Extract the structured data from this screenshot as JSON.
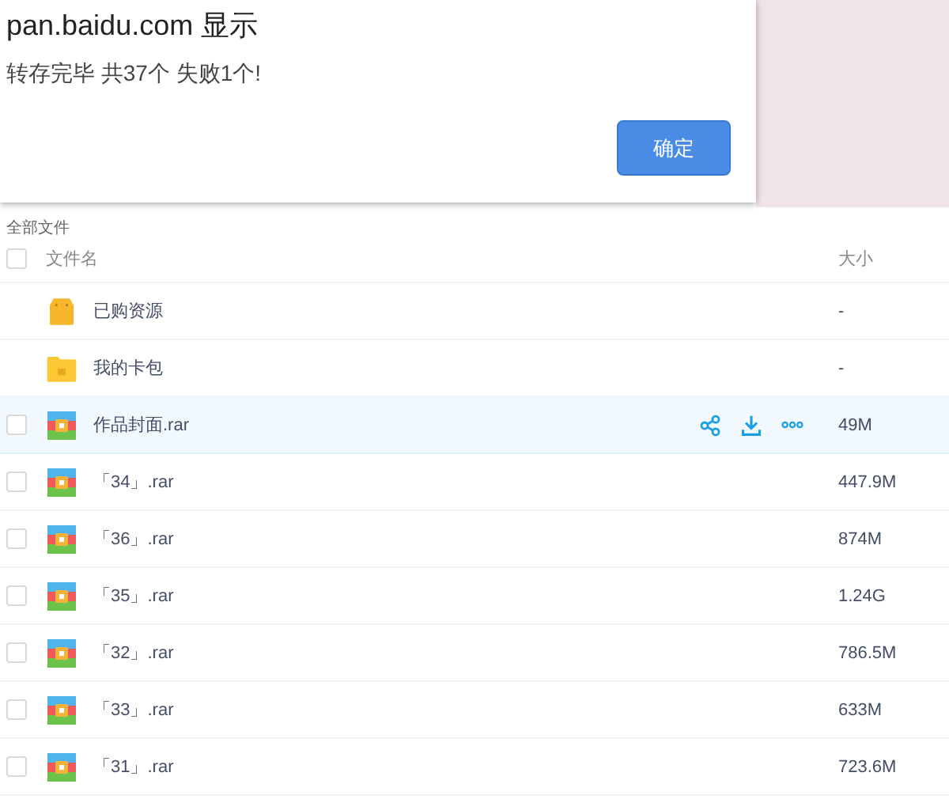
{
  "dialog": {
    "title": "pan.baidu.com 显示",
    "message": "转存完毕 共37个 失败1个!",
    "buttons": [
      "确定"
    ]
  },
  "breadcrumb": "全部文件",
  "table": {
    "all_checked": false,
    "columns": [
      "文件名",
      "大小"
    ],
    "rows": [
      {
        "kind": "bag",
        "name": "已购资源",
        "size": "-",
        "hovered": false
      },
      {
        "kind": "folder",
        "name": "我的卡包",
        "size": "-",
        "hovered": false
      },
      {
        "kind": "rar",
        "name": "作品封面.rar",
        "size": "49M",
        "hovered": true
      },
      {
        "kind": "rar",
        "name": "「34」.rar",
        "size": "447.9M",
        "hovered": false
      },
      {
        "kind": "rar",
        "name": "「36」.rar",
        "size": "874M",
        "hovered": false
      },
      {
        "kind": "rar",
        "name": "「35」.rar",
        "size": "1.24G",
        "hovered": false
      },
      {
        "kind": "rar",
        "name": "「32」.rar",
        "size": "786.5M",
        "hovered": false
      },
      {
        "kind": "rar",
        "name": "「33」.rar",
        "size": "633M",
        "hovered": false
      },
      {
        "kind": "rar",
        "name": "「31」.rar",
        "size": "723.6M",
        "hovered": false
      }
    ]
  }
}
